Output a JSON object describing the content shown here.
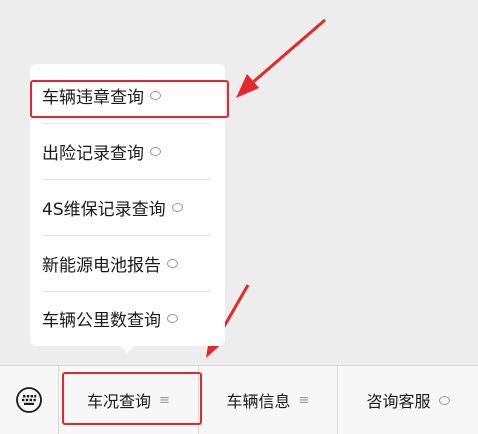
{
  "menu": {
    "items": [
      {
        "label": "车辆违章查询"
      },
      {
        "label": "出险记录查询"
      },
      {
        "label": "4S维保记录查询"
      },
      {
        "label": "新能源电池报告"
      },
      {
        "label": "车辆公里数查询"
      }
    ]
  },
  "tabbar": {
    "tabs": [
      {
        "label": "车况查询",
        "icon": "menu-lines-icon"
      },
      {
        "label": "车辆信息",
        "icon": "menu-lines-icon"
      },
      {
        "label": "咨询客服",
        "icon": "chat-bubble-icon"
      }
    ]
  },
  "colors": {
    "highlight": "#e6272a",
    "background": "#ededed"
  }
}
